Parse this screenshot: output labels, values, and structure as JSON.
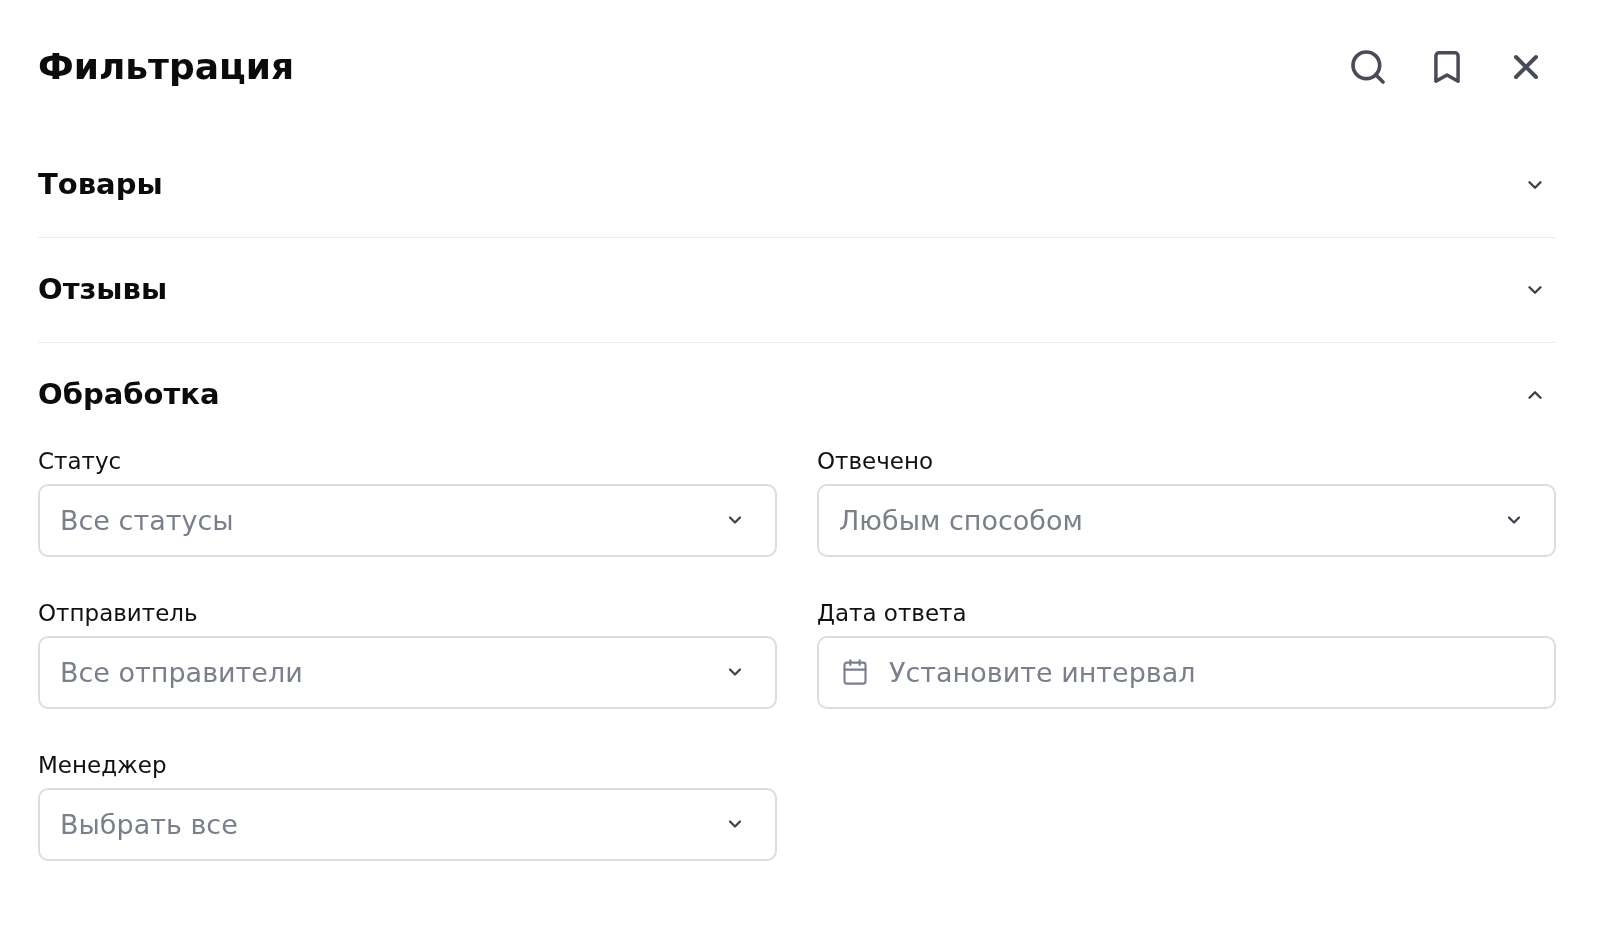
{
  "header": {
    "title": "Фильтрация"
  },
  "sections": [
    {
      "title": "Товары",
      "expanded": false
    },
    {
      "title": "Отзывы",
      "expanded": false
    },
    {
      "title": "Обработка",
      "expanded": true,
      "fields": [
        {
          "label": "Статус",
          "kind": "select",
          "placeholder": "Все статусы"
        },
        {
          "label": "Отвечено",
          "kind": "select",
          "placeholder": "Любым способом"
        },
        {
          "label": "Отправитель",
          "kind": "select",
          "placeholder": "Все отправители"
        },
        {
          "label": "Дата ответа",
          "kind": "date",
          "placeholder": "Установите интервал"
        },
        {
          "label": "Менеджер",
          "kind": "select",
          "placeholder": "Выбрать все"
        }
      ]
    }
  ]
}
